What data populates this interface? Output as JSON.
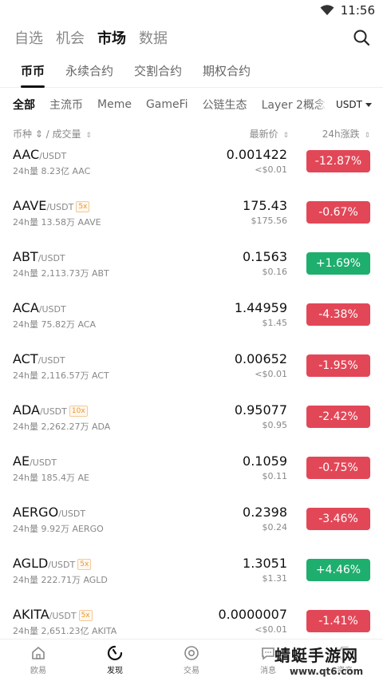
{
  "status_bar": {
    "time": "11:56"
  },
  "top_nav": {
    "items": [
      "自选",
      "机会",
      "市场",
      "数据"
    ],
    "active": 2
  },
  "sub_tabs": {
    "items": [
      "币币",
      "永续合约",
      "交割合约",
      "期权合约"
    ],
    "active": 0
  },
  "categories": {
    "items": [
      "全部",
      "主流币",
      "Meme",
      "GameFi",
      "公链生态",
      "Layer 2概念"
    ],
    "active": 0,
    "currency": "USDT"
  },
  "columns": {
    "pair_volume": "币种 ⇕ / 成交量",
    "last_price": "最新价",
    "change": "24h涨跌"
  },
  "rows": [
    {
      "base": "AAC",
      "quote": "/USDT",
      "leverage": "",
      "volume": "24h量 8.23亿 AAC",
      "price": "0.001422",
      "fiat": "<$0.01",
      "change": "-12.87%",
      "dir": "down"
    },
    {
      "base": "AAVE",
      "quote": "/USDT",
      "leverage": "5x",
      "volume": "24h量 13.58万 AAVE",
      "price": "175.43",
      "fiat": "$175.56",
      "change": "-0.67%",
      "dir": "down"
    },
    {
      "base": "ABT",
      "quote": "/USDT",
      "leverage": "",
      "volume": "24h量 2,113.73万 ABT",
      "price": "0.1563",
      "fiat": "$0.16",
      "change": "+1.69%",
      "dir": "up"
    },
    {
      "base": "ACA",
      "quote": "/USDT",
      "leverage": "",
      "volume": "24h量 75.82万 ACA",
      "price": "1.44959",
      "fiat": "$1.45",
      "change": "-4.38%",
      "dir": "down"
    },
    {
      "base": "ACT",
      "quote": "/USDT",
      "leverage": "",
      "volume": "24h量 2,116.57万 ACT",
      "price": "0.00652",
      "fiat": "<$0.01",
      "change": "-1.95%",
      "dir": "down"
    },
    {
      "base": "ADA",
      "quote": "/USDT",
      "leverage": "10x",
      "volume": "24h量 2,262.27万 ADA",
      "price": "0.95077",
      "fiat": "$0.95",
      "change": "-2.42%",
      "dir": "down"
    },
    {
      "base": "AE",
      "quote": "/USDT",
      "leverage": "",
      "volume": "24h量 185.4万 AE",
      "price": "0.1059",
      "fiat": "$0.11",
      "change": "-0.75%",
      "dir": "down"
    },
    {
      "base": "AERGO",
      "quote": "/USDT",
      "leverage": "",
      "volume": "24h量 9.92万 AERGO",
      "price": "0.2398",
      "fiat": "$0.24",
      "change": "-3.46%",
      "dir": "down"
    },
    {
      "base": "AGLD",
      "quote": "/USDT",
      "leverage": "5x",
      "volume": "24h量 222.71万 AGLD",
      "price": "1.3051",
      "fiat": "$1.31",
      "change": "+4.46%",
      "dir": "up"
    },
    {
      "base": "AKITA",
      "quote": "/USDT",
      "leverage": "5x",
      "volume": "24h量 2,651.23亿 AKITA",
      "price": "0.0000007",
      "fiat": "<$0.01",
      "change": "-1.41%",
      "dir": "down"
    }
  ],
  "bottom_nav": {
    "items": [
      "欧易",
      "发现",
      "交易",
      "消息",
      "资产"
    ],
    "active": 1
  },
  "watermark": {
    "text": "蜻蜓手游网",
    "url": "www.qt6.com"
  },
  "colors": {
    "down": "#e24757",
    "up": "#1eae6e"
  }
}
